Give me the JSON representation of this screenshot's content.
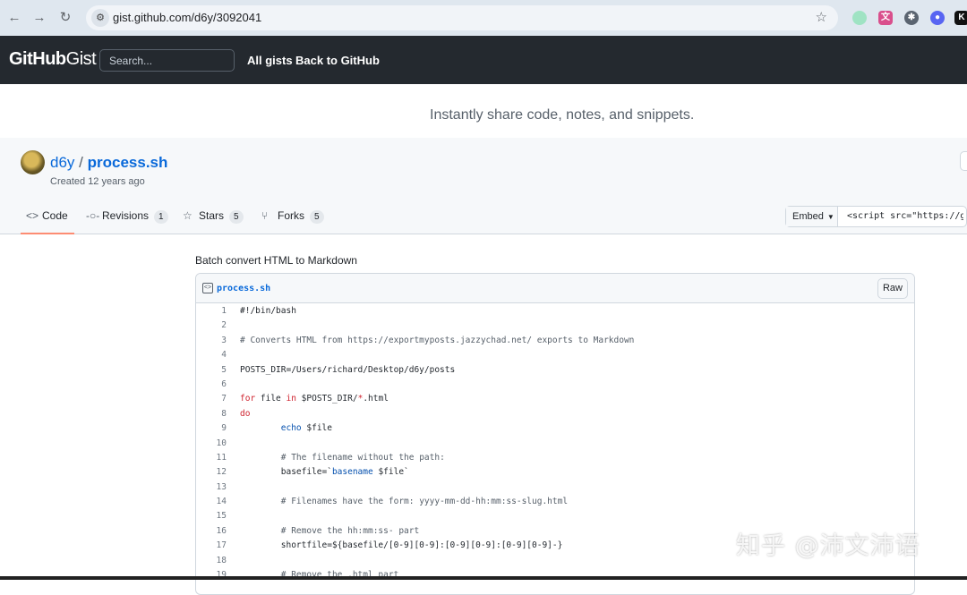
{
  "browser": {
    "url": "gist.github.com/d6y/3092041",
    "extensions": [
      "translate-ext",
      "bug-ext",
      "discord-ext",
      "k-ext"
    ]
  },
  "header": {
    "logo_bold": "GitHub",
    "logo_light": "Gist",
    "search_placeholder": "Search...",
    "all_gists": "All gists",
    "back_to_github": "Back to GitHub"
  },
  "tagline": "Instantly share code, notes, and snippets.",
  "gist": {
    "owner": "d6y",
    "separator": "/",
    "filename_title": "process.sh",
    "created": "Created 12 years ago",
    "tabs": [
      {
        "label": "Code",
        "icon": "code-icon",
        "count": ""
      },
      {
        "label": "Revisions",
        "icon": "commit-icon",
        "count": "1"
      },
      {
        "label": "Stars",
        "icon": "star-icon",
        "count": "5"
      },
      {
        "label": "Forks",
        "icon": "fork-icon",
        "count": "5"
      }
    ],
    "embed_label": "Embed",
    "embed_value": "<script src=\"https://g",
    "description": "Batch convert HTML to Markdown",
    "file": {
      "name": "process.sh",
      "raw_label": "Raw"
    }
  },
  "watermark": "知乎 @沛文沛语",
  "colors": {
    "header_bg": "#24292f",
    "link": "#0969da",
    "active_tab": "#fd8c73"
  }
}
